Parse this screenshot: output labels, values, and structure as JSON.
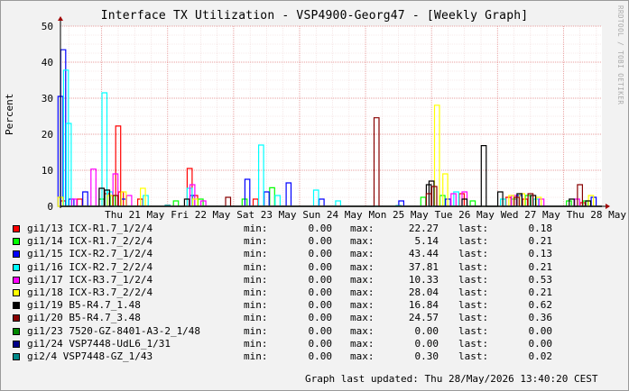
{
  "chart_data": {
    "type": "line",
    "title": "Interface TX Utilization - VSP4900-Georg47 - [Weekly Graph]",
    "ylabel": "Percent",
    "ylim": [
      0,
      50
    ],
    "yticks": [
      0,
      10,
      20,
      30,
      40,
      50
    ],
    "x_range": [
      "2026-05-20T09:00",
      "2026-05-28T14:00"
    ],
    "xticks": [
      {
        "label": "Thu 21 May",
        "at": "2026-05-21"
      },
      {
        "label": "Fri 22 May",
        "at": "2026-05-22"
      },
      {
        "label": "Sat 23 May",
        "at": "2026-05-23"
      },
      {
        "label": "Sun 24 May",
        "at": "2026-05-24"
      },
      {
        "label": "Mon 25 May",
        "at": "2026-05-25"
      },
      {
        "label": "Tue 26 May",
        "at": "2026-05-26"
      },
      {
        "label": "Wed 27 May",
        "at": "2026-05-27"
      },
      {
        "label": "Thu 28 May",
        "at": "2026-05-28"
      }
    ],
    "grid": true,
    "series": [
      {
        "name": "gi1/13 ICX-R1.7_1/2/4",
        "color": "#FF0000",
        "min": "0.00",
        "max": "22.27",
        "last": "0.18",
        "peaks": [
          [
            "2026-05-20T10:00",
            1.5
          ],
          [
            "2026-05-20T16:00",
            2
          ],
          [
            "2026-05-21T02:00",
            3.5
          ],
          [
            "2026-05-21T06:00",
            22.27
          ],
          [
            "2026-05-21T07:00",
            4
          ],
          [
            "2026-05-21T14:00",
            2
          ],
          [
            "2026-05-22T08:00",
            10.5
          ],
          [
            "2026-05-22T10:00",
            3
          ],
          [
            "2026-05-23T08:00",
            2
          ],
          [
            "2026-05-26T11:00",
            3.5
          ],
          [
            "2026-05-27T04:00",
            2.5
          ],
          [
            "2026-05-27T10:00",
            2
          ],
          [
            "2026-05-28T07:00",
            1
          ]
        ]
      },
      {
        "name": "gi1/14 ICX-R1.7_2/2/4",
        "color": "#00FF00",
        "min": "0.00",
        "max": "5.14",
        "last": "0.21",
        "peaks": [
          [
            "2026-05-21T00:00",
            2
          ],
          [
            "2026-05-21T04:00",
            3
          ],
          [
            "2026-05-22T03:00",
            1.5
          ],
          [
            "2026-05-22T12:00",
            2
          ],
          [
            "2026-05-23T04:00",
            2
          ],
          [
            "2026-05-23T14:00",
            5.14
          ],
          [
            "2026-05-25T21:00",
            2.5
          ],
          [
            "2026-05-26T04:00",
            3
          ],
          [
            "2026-05-26T15:00",
            1.5
          ],
          [
            "2026-05-27T06:00",
            2
          ],
          [
            "2026-05-27T11:00",
            3
          ],
          [
            "2026-05-28T02:00",
            1.5
          ],
          [
            "2026-05-28T08:00",
            1.5
          ]
        ]
      },
      {
        "name": "gi1/15 ICX-R2.7_1/2/4",
        "color": "#0000FF",
        "min": "0.00",
        "max": "43.44",
        "last": "0.13",
        "peaks": [
          [
            "2026-05-20T09:00",
            30.5
          ],
          [
            "2026-05-20T10:00",
            43.44
          ],
          [
            "2026-05-20T13:00",
            2
          ],
          [
            "2026-05-20T18:00",
            4
          ],
          [
            "2026-05-21T08:00",
            2
          ],
          [
            "2026-05-22T09:00",
            3
          ],
          [
            "2026-05-23T05:00",
            7.5
          ],
          [
            "2026-05-23T12:00",
            4
          ],
          [
            "2026-05-23T20:00",
            6.5
          ],
          [
            "2026-05-24T08:00",
            2
          ],
          [
            "2026-05-25T13:00",
            1.5
          ],
          [
            "2026-05-26T06:00",
            2
          ],
          [
            "2026-05-27T08:00",
            3
          ],
          [
            "2026-05-28T11:00",
            2.5
          ]
        ]
      },
      {
        "name": "gi1/16 ICX-R2.7_2/2/4",
        "color": "#00FFFF",
        "min": "0.00",
        "max": "37.81",
        "last": "0.21",
        "peaks": [
          [
            "2026-05-20T11:00",
            37.81
          ],
          [
            "2026-05-20T12:00",
            23
          ],
          [
            "2026-05-21T01:00",
            31.5
          ],
          [
            "2026-05-21T03:00",
            4
          ],
          [
            "2026-05-21T16:00",
            3
          ],
          [
            "2026-05-22T08:00",
            5
          ],
          [
            "2026-05-23T10:00",
            17
          ],
          [
            "2026-05-23T16:00",
            3
          ],
          [
            "2026-05-24T06:00",
            4.5
          ],
          [
            "2026-05-24T14:00",
            1.5
          ],
          [
            "2026-05-26T09:00",
            4
          ],
          [
            "2026-05-27T02:00",
            2
          ],
          [
            "2026-05-27T14:00",
            2
          ]
        ]
      },
      {
        "name": "gi1/17 ICX-R3.7_1/2/4",
        "color": "#FF00FF",
        "min": "0.00",
        "max": "10.33",
        "last": "0.53",
        "peaks": [
          [
            "2026-05-20T14:00",
            2
          ],
          [
            "2026-05-20T21:00",
            10.33
          ],
          [
            "2026-05-21T05:00",
            9
          ],
          [
            "2026-05-21T10:00",
            3
          ],
          [
            "2026-05-22T09:00",
            6
          ],
          [
            "2026-05-22T13:00",
            1.5
          ],
          [
            "2026-05-26T08:00",
            3.5
          ],
          [
            "2026-05-26T12:00",
            4
          ],
          [
            "2026-05-27T06:00",
            3
          ],
          [
            "2026-05-27T16:00",
            2
          ],
          [
            "2026-05-28T05:00",
            2
          ]
        ]
      },
      {
        "name": "gi1/18 ICX-R3.7_2/2/4",
        "color": "#FFFF00",
        "min": "0.00",
        "max": "28.04",
        "last": "0.21",
        "peaks": [
          [
            "2026-05-20T09:00",
            2.5
          ],
          [
            "2026-05-21T03:00",
            3
          ],
          [
            "2026-05-21T08:00",
            4
          ],
          [
            "2026-05-21T15:00",
            5
          ],
          [
            "2026-05-22T10:00",
            2
          ],
          [
            "2026-05-26T02:00",
            28.04
          ],
          [
            "2026-05-26T05:00",
            9
          ],
          [
            "2026-05-27T05:00",
            3
          ],
          [
            "2026-05-27T09:00",
            3.5
          ],
          [
            "2026-05-27T15:00",
            2.5
          ],
          [
            "2026-05-28T10:00",
            3
          ]
        ]
      },
      {
        "name": "gi1/19 B5-R4.7_1.48",
        "color": "#000000",
        "min": "0.00",
        "max": "16.84",
        "last": "0.62",
        "peaks": [
          [
            "2026-05-21T00:00",
            5
          ],
          [
            "2026-05-21T02:00",
            4.5
          ],
          [
            "2026-05-22T07:00",
            2
          ],
          [
            "2026-05-25T23:00",
            6
          ],
          [
            "2026-05-26T00:00",
            7
          ],
          [
            "2026-05-26T12:00",
            2
          ],
          [
            "2026-05-26T19:00",
            16.84
          ],
          [
            "2026-05-27T01:00",
            4
          ],
          [
            "2026-05-27T08:00",
            3.5
          ],
          [
            "2026-05-27T13:00",
            3
          ],
          [
            "2026-05-28T03:00",
            2
          ],
          [
            "2026-05-28T09:00",
            1.5
          ]
        ]
      },
      {
        "name": "gi1/20 B5-R4.7_3.48",
        "color": "#880000",
        "min": "0.00",
        "max": "24.57",
        "last": "0.36",
        "peaks": [
          [
            "2026-05-21T05:00",
            3
          ],
          [
            "2026-05-22T22:00",
            2.5
          ],
          [
            "2026-05-25T04:00",
            24.57
          ],
          [
            "2026-05-25T23:00",
            3.5
          ],
          [
            "2026-05-26T01:00",
            5.5
          ],
          [
            "2026-05-27T07:00",
            2.5
          ],
          [
            "2026-05-27T12:00",
            3.5
          ],
          [
            "2026-05-28T06:00",
            6
          ]
        ]
      },
      {
        "name": "gi1/23 7520-GZ-8401-A3-2_1/48",
        "color": "#008800",
        "min": "0.00",
        "max": "0.00",
        "last": "0.00",
        "peaks": []
      },
      {
        "name": "gi1/24 VSP7448-UdL6_1/31",
        "color": "#000088",
        "min": "0.00",
        "max": "0.00",
        "last": "0.00",
        "peaks": []
      },
      {
        "name": "gi2/4 VSP7448-GZ_1/43",
        "color": "#008888",
        "min": "0.00",
        "max": "0.30",
        "last": "0.02",
        "peaks": [
          [
            "2026-05-22T00:00",
            0.3
          ],
          [
            "2026-05-25T12:00",
            0.2
          ]
        ]
      }
    ]
  },
  "legend_labels": {
    "min": "min:",
    "max": "max:",
    "last": "last:"
  },
  "footer": "Graph last updated: Thu 28/May/2026 13:40:20 CEST",
  "watermark": "RRDTOOL / TOBI OETIKER"
}
